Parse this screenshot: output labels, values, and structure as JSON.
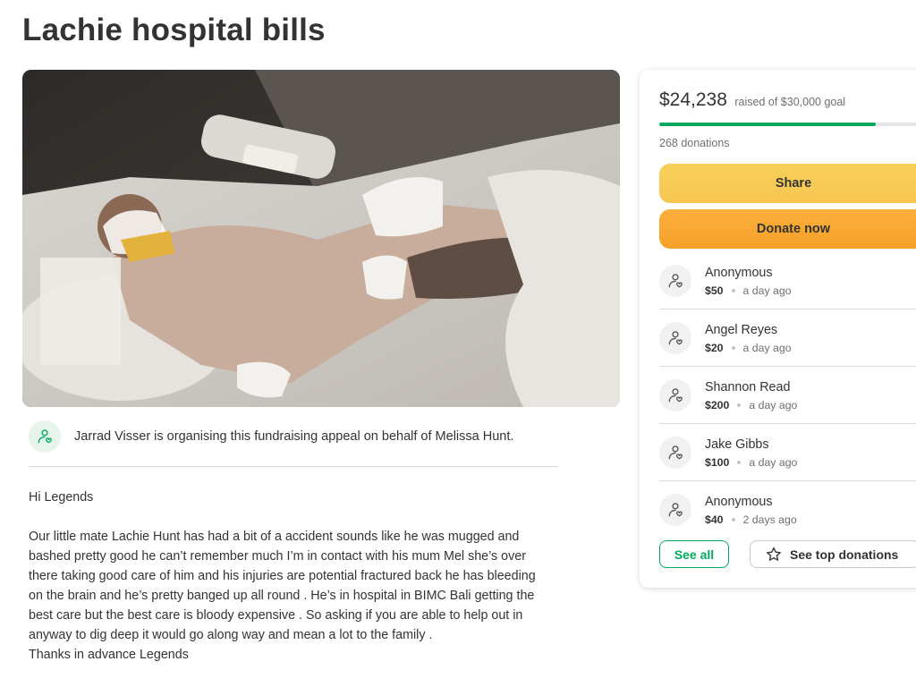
{
  "page": {
    "title": "Lachie hospital bills"
  },
  "organiser": {
    "text": "Jarrad Visser is organising this fundraising appeal on behalf of Melissa Hunt.",
    "icon": "heart-hand-icon"
  },
  "story": {
    "greeting": "Hi Legends",
    "body": "Our little mate Lachie Hunt has had a bit of a accident sounds like he was mugged and\nbashed pretty good he can’t remember much I’m in contact with his mum Mel she’s over\nthere taking good care of him and his injuries are potential fractured back he has bleeding\non the brain and he’s pretty banged up all round . He’s in hospital in BIMC Bali getting the\nbest care but the best care is bloody expensive . So asking if you are able to help out in\nanyway to dig deep it would go along way and mean a lot to the family .\nThanks in advance Legends"
  },
  "sidebar": {
    "raised_amount": "$24,238",
    "raised_of": "raised of $30,000 goal",
    "progress_fraction": 0.808,
    "donation_count": "268 donations",
    "share_label": "Share",
    "donate_label": "Donate now",
    "donations": [
      {
        "name": "Anonymous",
        "amount": "$50",
        "time": "a day ago"
      },
      {
        "name": "Angel Reyes",
        "amount": "$20",
        "time": "a day ago"
      },
      {
        "name": "Shannon Read",
        "amount": "$200",
        "time": "a day ago"
      },
      {
        "name": "Jake Gibbs",
        "amount": "$100",
        "time": "a day ago"
      },
      {
        "name": "Anonymous",
        "amount": "$40",
        "time": "2 days ago"
      }
    ],
    "see_all_label": "See all",
    "see_top_label": "See top donations"
  },
  "colors": {
    "brand_green": "#02a95c",
    "share_yellow": "#f8cf5b",
    "donate_orange": "#fbb03b",
    "text": "#333333",
    "muted": "#6f6f6f"
  }
}
